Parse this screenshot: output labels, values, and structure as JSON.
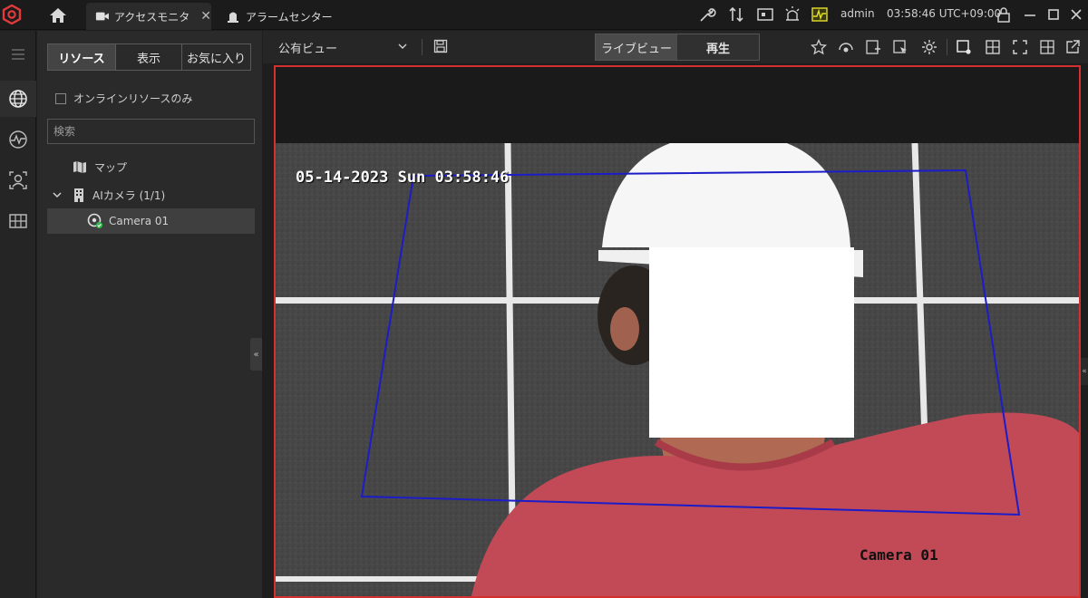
{
  "titlebar": {
    "tabs": [
      {
        "label": "アクセスモニタ",
        "icon": "video-camera-icon",
        "close": "✕"
      },
      {
        "label": "アラームセンター",
        "icon": "alarm-bell-icon"
      }
    ],
    "user": "admin",
    "clock": "03:58:46 UTC+09:00"
  },
  "panel": {
    "segments": [
      "リソース",
      "表示",
      "お気に入り"
    ],
    "online_only_label": "オンラインリソースのみ",
    "search_placeholder": "検索",
    "tree": {
      "map_label": "マップ",
      "group_label": "AIカメラ (1/1)",
      "camera_label": "Camera 01"
    },
    "collapse_glyph": "«"
  },
  "viewbar": {
    "view_name": "公有ビュー",
    "modes": [
      "ライブビュー",
      "再生"
    ]
  },
  "video": {
    "osd_timestamp": "05-14-2023 Sun 03:58:46",
    "osd_camera_name": "Camera 01",
    "border_color": "#d53030",
    "roi_color": "#1c1cc8"
  }
}
